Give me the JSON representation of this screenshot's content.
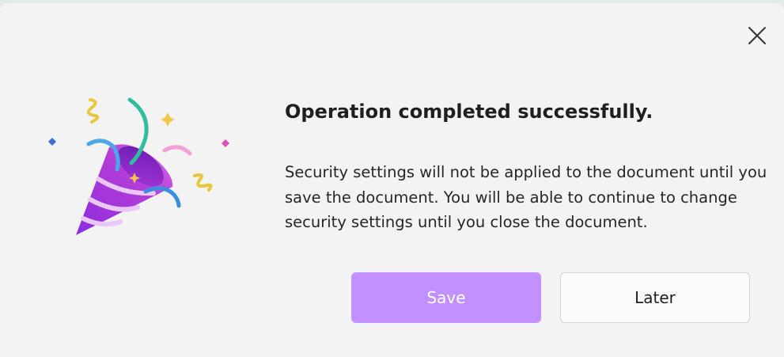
{
  "dialog": {
    "title": "Operation completed successfully.",
    "message": "Security settings will not be applied to the document until you save the document. You will be able to continue to change security settings until you close the document.",
    "close_icon": "close-icon",
    "illustration_icon": "party-popper-icon",
    "buttons": {
      "save_label": "Save",
      "later_label": "Later"
    }
  },
  "colors": {
    "primary_button": "#c391ff",
    "secondary_button": "#fbfbfb",
    "dialog_background": "#f3f3f3"
  }
}
